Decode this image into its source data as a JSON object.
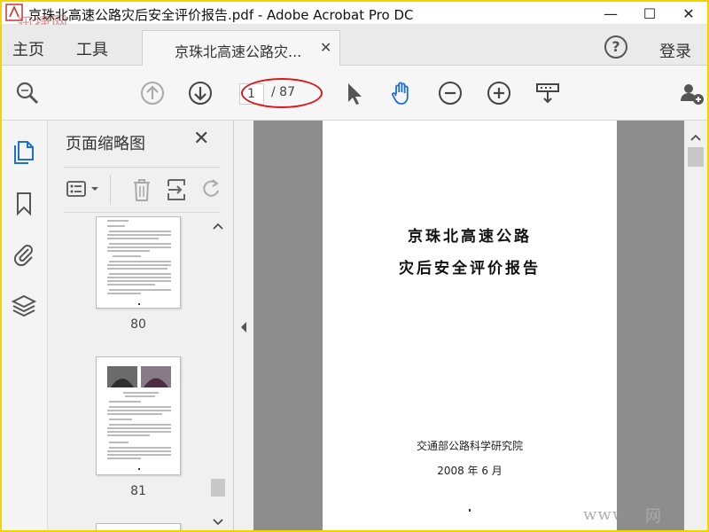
{
  "window": {
    "title": "京珠北高速公路灾后安全评价报告.pdf - Adobe Acrobat Pro DC",
    "logo_text": "迅捷网",
    "minimize": "—",
    "maximize": "☐",
    "close": "✕"
  },
  "tabs": {
    "home": "主页",
    "tools": "工具",
    "document": "京珠北高速公路灾...",
    "document_close": "✕",
    "login": "登录",
    "help": "?"
  },
  "toolbar": {
    "current_page": "1",
    "total_pages": "/ 87"
  },
  "thumbnails_panel": {
    "title": "页面缩略图",
    "close": "✕",
    "pages": [
      {
        "label": "80"
      },
      {
        "label": "81"
      }
    ]
  },
  "document": {
    "title_line1": "京珠北高速公路",
    "title_line2": "灾后安全评价报告",
    "organization": "交通部公路科学研究院",
    "date": "2008 年 6 月"
  },
  "watermark": {
    "site_left": "www.",
    "site_right": "网"
  },
  "colors": {
    "frame_border": "#f2d500",
    "active_tool": "#1f6fd1",
    "annotation_ellipse": "#d8181a",
    "doc_background": "#8d8d8d"
  }
}
